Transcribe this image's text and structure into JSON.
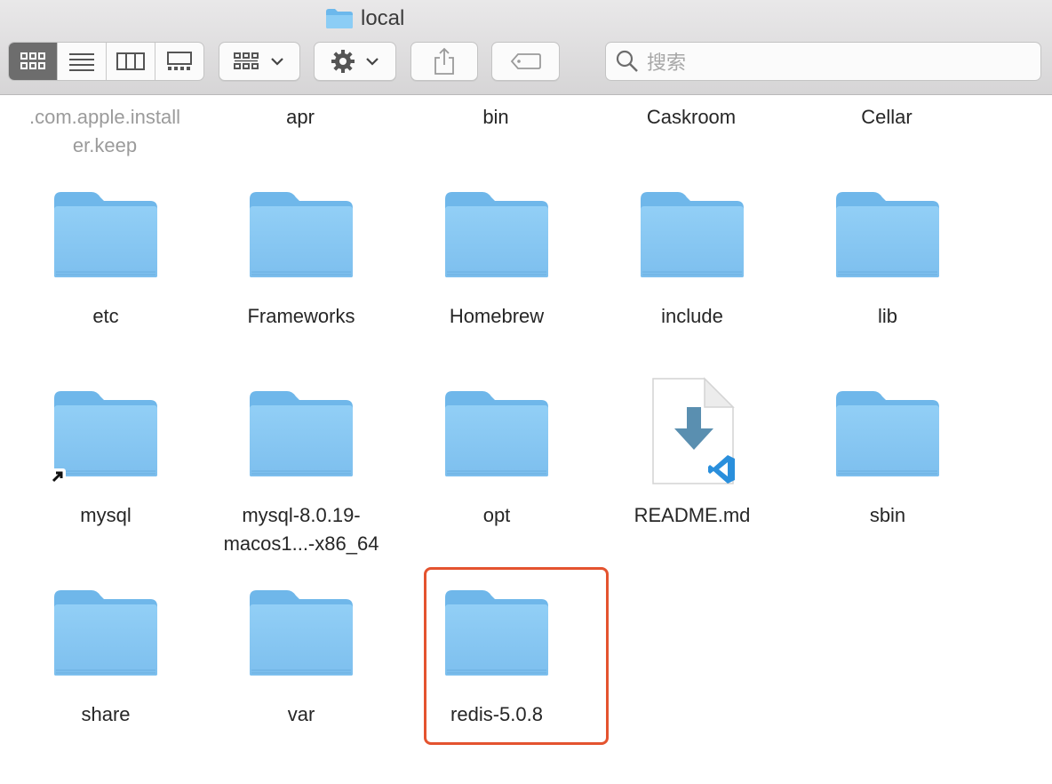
{
  "window": {
    "title": "local"
  },
  "toolbar": {
    "view_modes": [
      {
        "name": "icon-view-button",
        "icon": "grid-icon",
        "active": true
      },
      {
        "name": "list-view-button",
        "icon": "list-icon",
        "active": false
      },
      {
        "name": "column-view-button",
        "icon": "columns-icon",
        "active": false
      },
      {
        "name": "gallery-view-button",
        "icon": "gallery-icon",
        "active": false
      }
    ],
    "group_icon": "group-by-icon",
    "action_icon": "gear-icon",
    "share_icon": "share-icon",
    "tag_icon": "tag-icon",
    "search_placeholder": "搜索"
  },
  "top_row": [
    {
      "label": ".com.apple.install\ner.keep",
      "dim": true
    },
    {
      "label": "apr"
    },
    {
      "label": "bin"
    },
    {
      "label": "Caskroom"
    },
    {
      "label": "Cellar"
    }
  ],
  "items": [
    {
      "name": "etc",
      "type": "folder"
    },
    {
      "name": "Frameworks",
      "type": "folder"
    },
    {
      "name": "Homebrew",
      "type": "folder"
    },
    {
      "name": "include",
      "type": "folder"
    },
    {
      "name": "lib",
      "type": "folder"
    },
    {
      "name": "mysql",
      "type": "folder-alias"
    },
    {
      "name": "mysql-8.0.19-\nmacos1...-x86_64",
      "type": "folder"
    },
    {
      "name": "opt",
      "type": "folder"
    },
    {
      "name": "README.md",
      "type": "markdown-file"
    },
    {
      "name": "sbin",
      "type": "folder"
    },
    {
      "name": "share",
      "type": "folder"
    },
    {
      "name": "var",
      "type": "folder"
    },
    {
      "name": "redis-5.0.8",
      "type": "folder",
      "highlighted": true
    }
  ],
  "colors": {
    "highlight": "#e4532f",
    "folder": "#8cc9f3"
  }
}
